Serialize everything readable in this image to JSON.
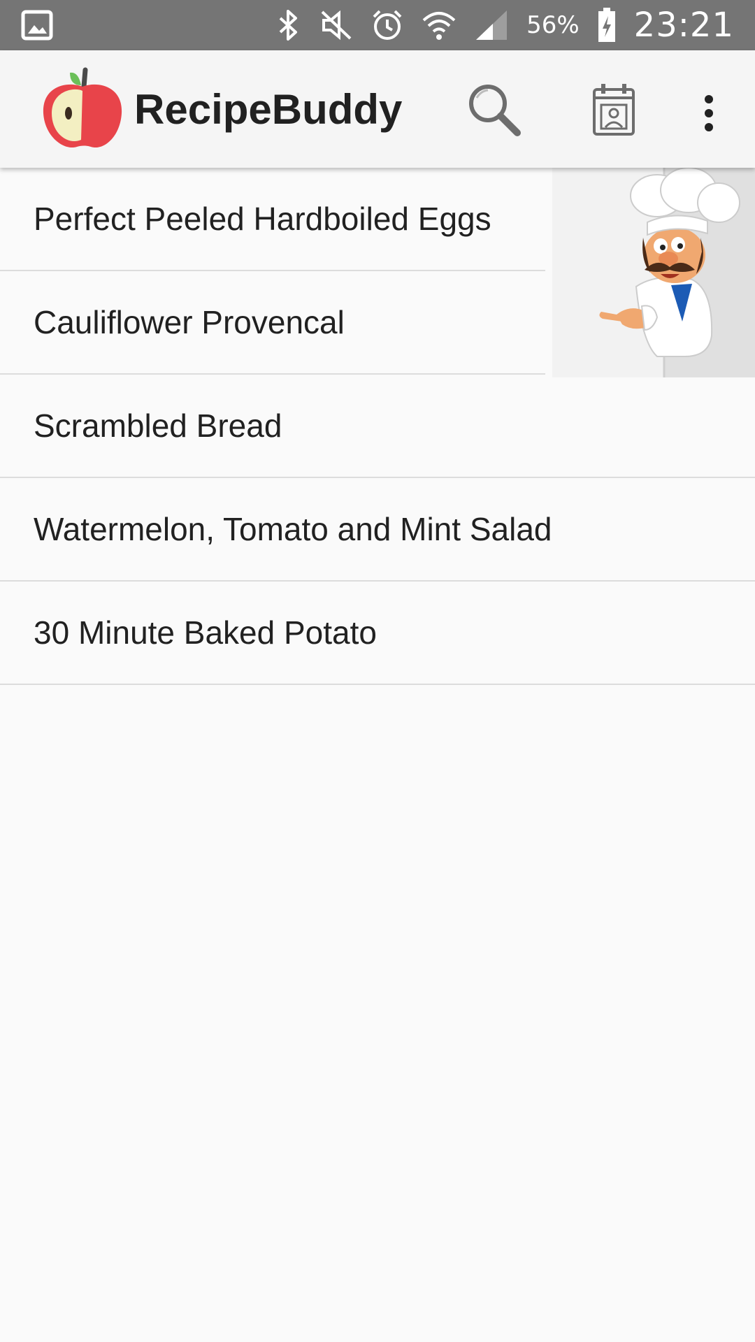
{
  "status_bar": {
    "battery_percent": "56%",
    "time": "23:21",
    "icons": [
      "image-icon",
      "bluetooth-icon",
      "mute-icon",
      "alarm-icon",
      "wifi-icon",
      "signal-icon",
      "battery-charging-icon"
    ]
  },
  "app_bar": {
    "title": "RecipeBuddy",
    "icons": [
      "apple-logo-icon",
      "search-icon",
      "calendar-icon",
      "more-vert-icon"
    ]
  },
  "recipes": [
    "Perfect Peeled Hardboiled Eggs",
    "Cauliflower Provencal",
    "Scrambled Bread",
    "Watermelon, Tomato and Mint Salad",
    "30 Minute Baked Potato"
  ],
  "colors": {
    "status_bar": "#757575",
    "app_bar": "#f5f5f5",
    "background": "#fafafa",
    "text": "#212121",
    "divider": "#dcdcdc"
  }
}
